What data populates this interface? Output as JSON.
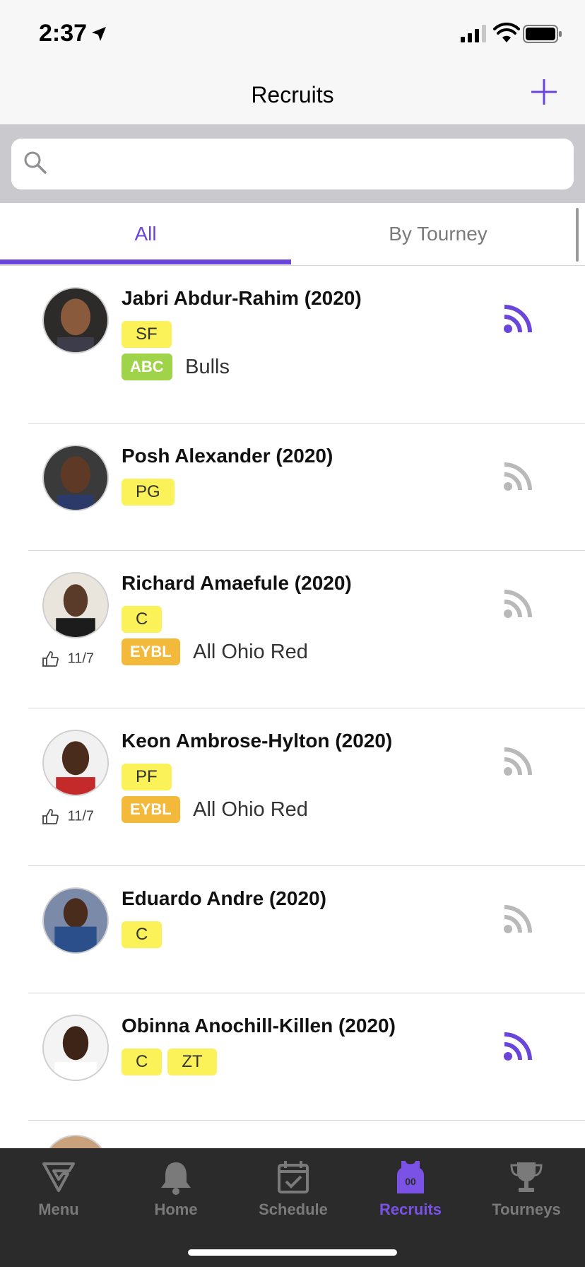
{
  "status": {
    "time": "2:37"
  },
  "nav": {
    "title": "Recruits",
    "add_icon": "plus-icon"
  },
  "search": {
    "placeholder": "",
    "value": ""
  },
  "tabs": [
    {
      "label": "All",
      "selected": true
    },
    {
      "label": "By Tourney",
      "selected": false
    }
  ],
  "colors": {
    "accent": "#6a45d9",
    "tag_yellow": "#fbf25a",
    "abc_green": "#9fd44a",
    "eybl_orange": "#f2b93b",
    "feed_active": "#6a45d9",
    "feed_inactive": "#b9b9b9",
    "tabbar_bg": "#2b2b2b"
  },
  "recruits": [
    {
      "name": "Jabri Abdur-Rahim (2020)",
      "positions": [
        "SF"
      ],
      "league": "ABC",
      "team": "Bulls",
      "likes": "",
      "following": true
    },
    {
      "name": "Posh Alexander (2020)",
      "positions": [
        "PG"
      ],
      "league": "",
      "team": "",
      "likes": "",
      "following": false
    },
    {
      "name": "Richard Amaefule (2020)",
      "positions": [
        "C"
      ],
      "league": "EYBL",
      "team": "All Ohio Red",
      "likes": "11/7",
      "following": false
    },
    {
      "name": "Keon Ambrose-Hylton (2020)",
      "positions": [
        "PF"
      ],
      "league": "EYBL",
      "team": "All Ohio Red",
      "likes": "11/7",
      "following": false
    },
    {
      "name": "Eduardo Andre (2020)",
      "positions": [
        "C"
      ],
      "league": "",
      "team": "",
      "likes": "",
      "following": false
    },
    {
      "name": "Obinna Anochill-Killen (2020)",
      "positions": [
        "C",
        "ZT"
      ],
      "league": "",
      "team": "",
      "likes": "",
      "following": true
    }
  ],
  "tabbar": [
    {
      "label": "Menu",
      "icon": "logo-icon",
      "active": false
    },
    {
      "label": "Home",
      "icon": "bell-icon",
      "active": false
    },
    {
      "label": "Schedule",
      "icon": "calendar-check-icon",
      "active": false
    },
    {
      "label": "Recruits",
      "icon": "jersey-icon",
      "active": true,
      "badge": "00"
    },
    {
      "label": "Tourneys",
      "icon": "trophy-icon",
      "active": false
    }
  ]
}
